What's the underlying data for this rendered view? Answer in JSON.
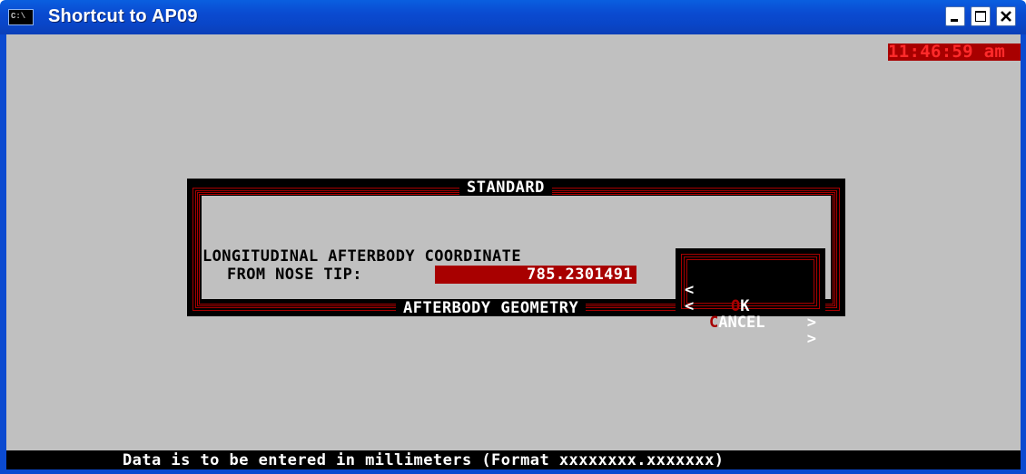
{
  "window": {
    "title": "Shortcut to AP09",
    "icon_label": "C:\\",
    "controls": [
      "minimize",
      "maximize",
      "close"
    ]
  },
  "clock": {
    "time": "11:46:59 am"
  },
  "dialog": {
    "title": "STANDARD",
    "footer": "AFTERBODY GEOMETRY",
    "field_label_line1": "LONGITUDINAL AFTERBODY COORDINATE",
    "field_label_line2": "FROM NOSE TIP:",
    "field_value": "785.2301491",
    "buttons": {
      "ok": {
        "hotkey": "O",
        "rest": "K",
        "left_bracket": "<",
        "right_bracket": ">"
      },
      "cancel": {
        "hotkey": "C",
        "rest": "ANCEL",
        "left_bracket": "<",
        "right_bracket": ">"
      }
    }
  },
  "status": {
    "message": "Data is to be entered in millimeters (Format xxxxxxxx.xxxxxxx)"
  },
  "colors": {
    "console_bg": "#c0c0c0",
    "accent_red": "#a80000",
    "title_bar_blue": "#0a5fe0"
  }
}
